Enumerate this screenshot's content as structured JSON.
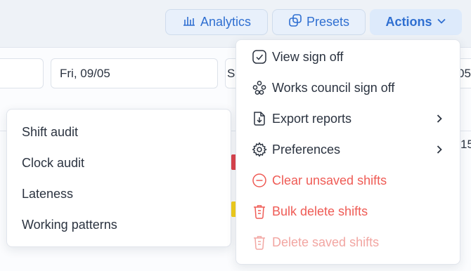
{
  "toolbar": {
    "analytics_label": "Analytics",
    "presets_label": "Presets",
    "actions_label": "Actions",
    "accent_color": "#2f6fd1"
  },
  "dates": {
    "visible_date": "Fri, 09/05",
    "partial_left": "S",
    "partial_right": "05"
  },
  "background": {
    "right_partial_number": "15"
  },
  "reports_menu": {
    "items": [
      {
        "label": "Shift audit"
      },
      {
        "label": "Clock audit"
      },
      {
        "label": "Lateness"
      },
      {
        "label": "Working patterns"
      }
    ]
  },
  "actions_menu": {
    "items": [
      {
        "label": "View sign off",
        "icon": "check-square-icon",
        "style": "normal"
      },
      {
        "label": "Works council sign off",
        "icon": "people-group-icon",
        "style": "normal"
      },
      {
        "label": "Export reports",
        "icon": "file-download-icon",
        "style": "normal",
        "submenu": true
      },
      {
        "label": "Preferences",
        "icon": "gear-icon",
        "style": "normal",
        "submenu": true
      },
      {
        "label": "Clear unsaved shifts",
        "icon": "minus-circle-icon",
        "style": "danger"
      },
      {
        "label": "Bulk delete shifts",
        "icon": "trash-icon",
        "style": "danger"
      },
      {
        "label": "Delete saved shifts",
        "icon": "trash-icon",
        "style": "danger-disabled"
      }
    ],
    "danger_color": "#ef5b55",
    "disabled_danger_color": "#f2a6a2"
  }
}
